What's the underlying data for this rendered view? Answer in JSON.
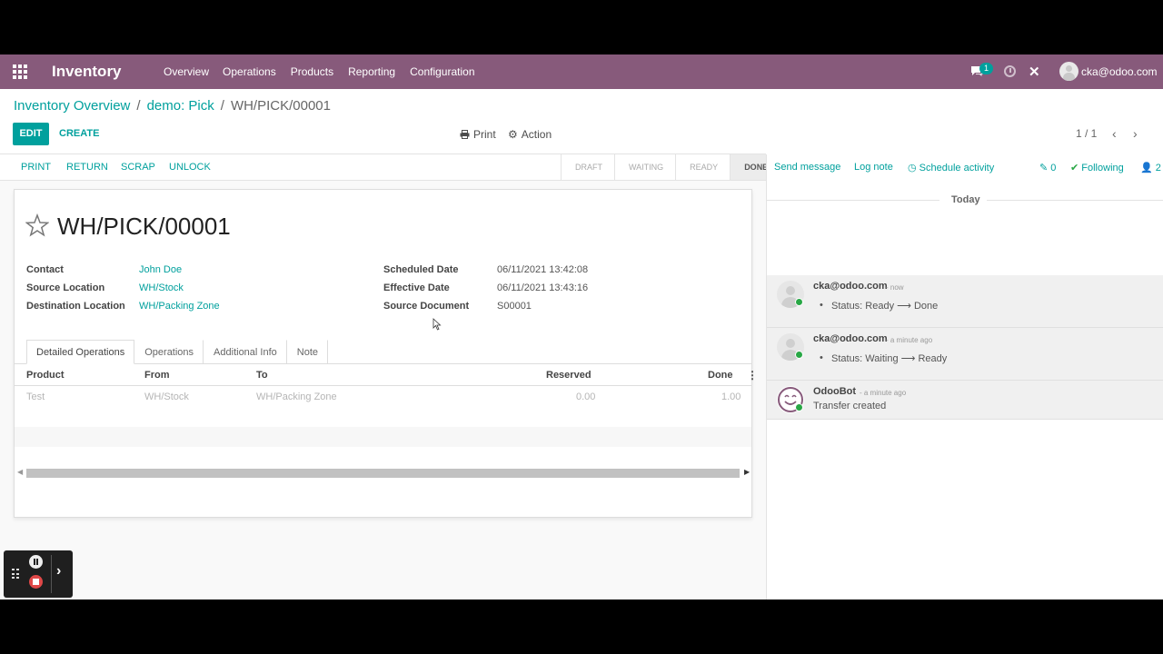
{
  "navbar": {
    "app_title": "Inventory",
    "menu": [
      "Overview",
      "Operations",
      "Products",
      "Reporting",
      "Configuration"
    ],
    "messages_count": "1",
    "user": "cka@odoo.com",
    "color": "#875a7b"
  },
  "breadcrumb": {
    "items": [
      "Inventory Overview",
      "demo: Pick"
    ],
    "current": "WH/PICK/00001",
    "separator": "/"
  },
  "buttons": {
    "edit": "EDIT",
    "create": "CREATE",
    "print": "Print",
    "action": "Action"
  },
  "pager": {
    "value": "1 / 1"
  },
  "statusbar": {
    "buttons": [
      "PRINT",
      "RETURN",
      "SCRAP",
      "UNLOCK"
    ],
    "stages": [
      "DRAFT",
      "WAITING",
      "READY",
      "DONE"
    ],
    "active_stage": "DONE"
  },
  "record": {
    "title": "WH/PICK/00001",
    "fields_left": [
      {
        "label": "Contact",
        "value": "John Doe"
      },
      {
        "label": "Source Location",
        "value": "WH/Stock"
      },
      {
        "label": "Destination Location",
        "value": "WH/Packing Zone"
      }
    ],
    "fields_right": [
      {
        "label": "Scheduled Date",
        "value": "06/11/2021 13:42:08"
      },
      {
        "label": "Effective Date",
        "value": "06/11/2021 13:43:16"
      },
      {
        "label": "Source Document",
        "value": "S00001"
      }
    ]
  },
  "tabs": [
    "Detailed Operations",
    "Operations",
    "Additional Info",
    "Note"
  ],
  "table": {
    "columns": [
      "Product",
      "From",
      "To",
      "Reserved",
      "Done"
    ],
    "rows": [
      {
        "product": "Test",
        "from": "WH/Stock",
        "to": "WH/Packing Zone",
        "reserved": "0.00",
        "done": "1.00"
      }
    ]
  },
  "chatter": {
    "send_message": "Send message",
    "log_note": "Log note",
    "schedule_activity": "Schedule activity",
    "attachments": "0",
    "following": "Following",
    "followers": "2",
    "day": "Today",
    "messages": [
      {
        "author": "cka@odoo.com",
        "date": "- now",
        "line": "Status: Ready ⟶ Done"
      },
      {
        "author": "cka@odoo.com",
        "date": "- a minute ago",
        "line": "Status: Waiting ⟶ Ready"
      },
      {
        "author": "OdooBot",
        "date": "- a minute ago",
        "line": "Transfer created"
      }
    ]
  },
  "accent_color": "#00a09d"
}
